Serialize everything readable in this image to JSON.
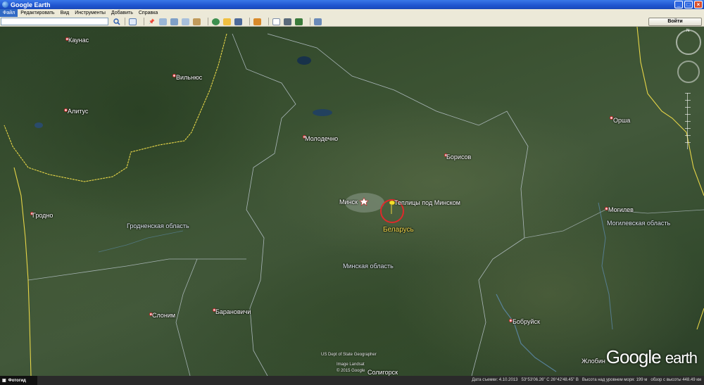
{
  "window": {
    "title": "Google Earth"
  },
  "menu": [
    "Файл",
    "Редактировать",
    "Вид",
    "Инструменты",
    "Добавить",
    "Справка"
  ],
  "search": {
    "value": ""
  },
  "toolbar": {
    "signout_label": "Войти"
  },
  "map": {
    "cities": {
      "kaunas": "Каунас",
      "vilnius": "Вильнюс",
      "alytus": "Алитус",
      "molodechno": "Молодечно",
      "borisov": "Борисов",
      "orsha": "Орша",
      "minsk": "Минск",
      "grodno": "Гродно",
      "mogilev": "Могилев",
      "slonim": "Слоним",
      "baranovichi": "Барановичи",
      "bobruisk": "Бобруйск",
      "soligorsk": "Солигорск",
      "zhlobin": "Жлобин"
    },
    "regions": {
      "grodno_oblast": "Гродненская область",
      "minsk_oblast": "Минская область",
      "mogilev_oblast": "Могилевская область"
    },
    "placemark": "Теплицы под Минском",
    "country": "Беларусь",
    "credits": {
      "line1": "US Dept of State Geographer",
      "line2": "Image Landsat",
      "line3": "© 2015 Google"
    },
    "logo": {
      "brand": "Google",
      "product": "earth"
    },
    "north_letter": "N"
  },
  "status": {
    "photo_tab": "Фотогид",
    "imagery_date": "Дата съемки: 4.10.2013",
    "coords": "53°53'06.26\" С  26°42'48.45\" В",
    "elevation": "Высота над уровнем моря:  199 м",
    "eye_alt": "обзор с высоты  448.49 км"
  }
}
